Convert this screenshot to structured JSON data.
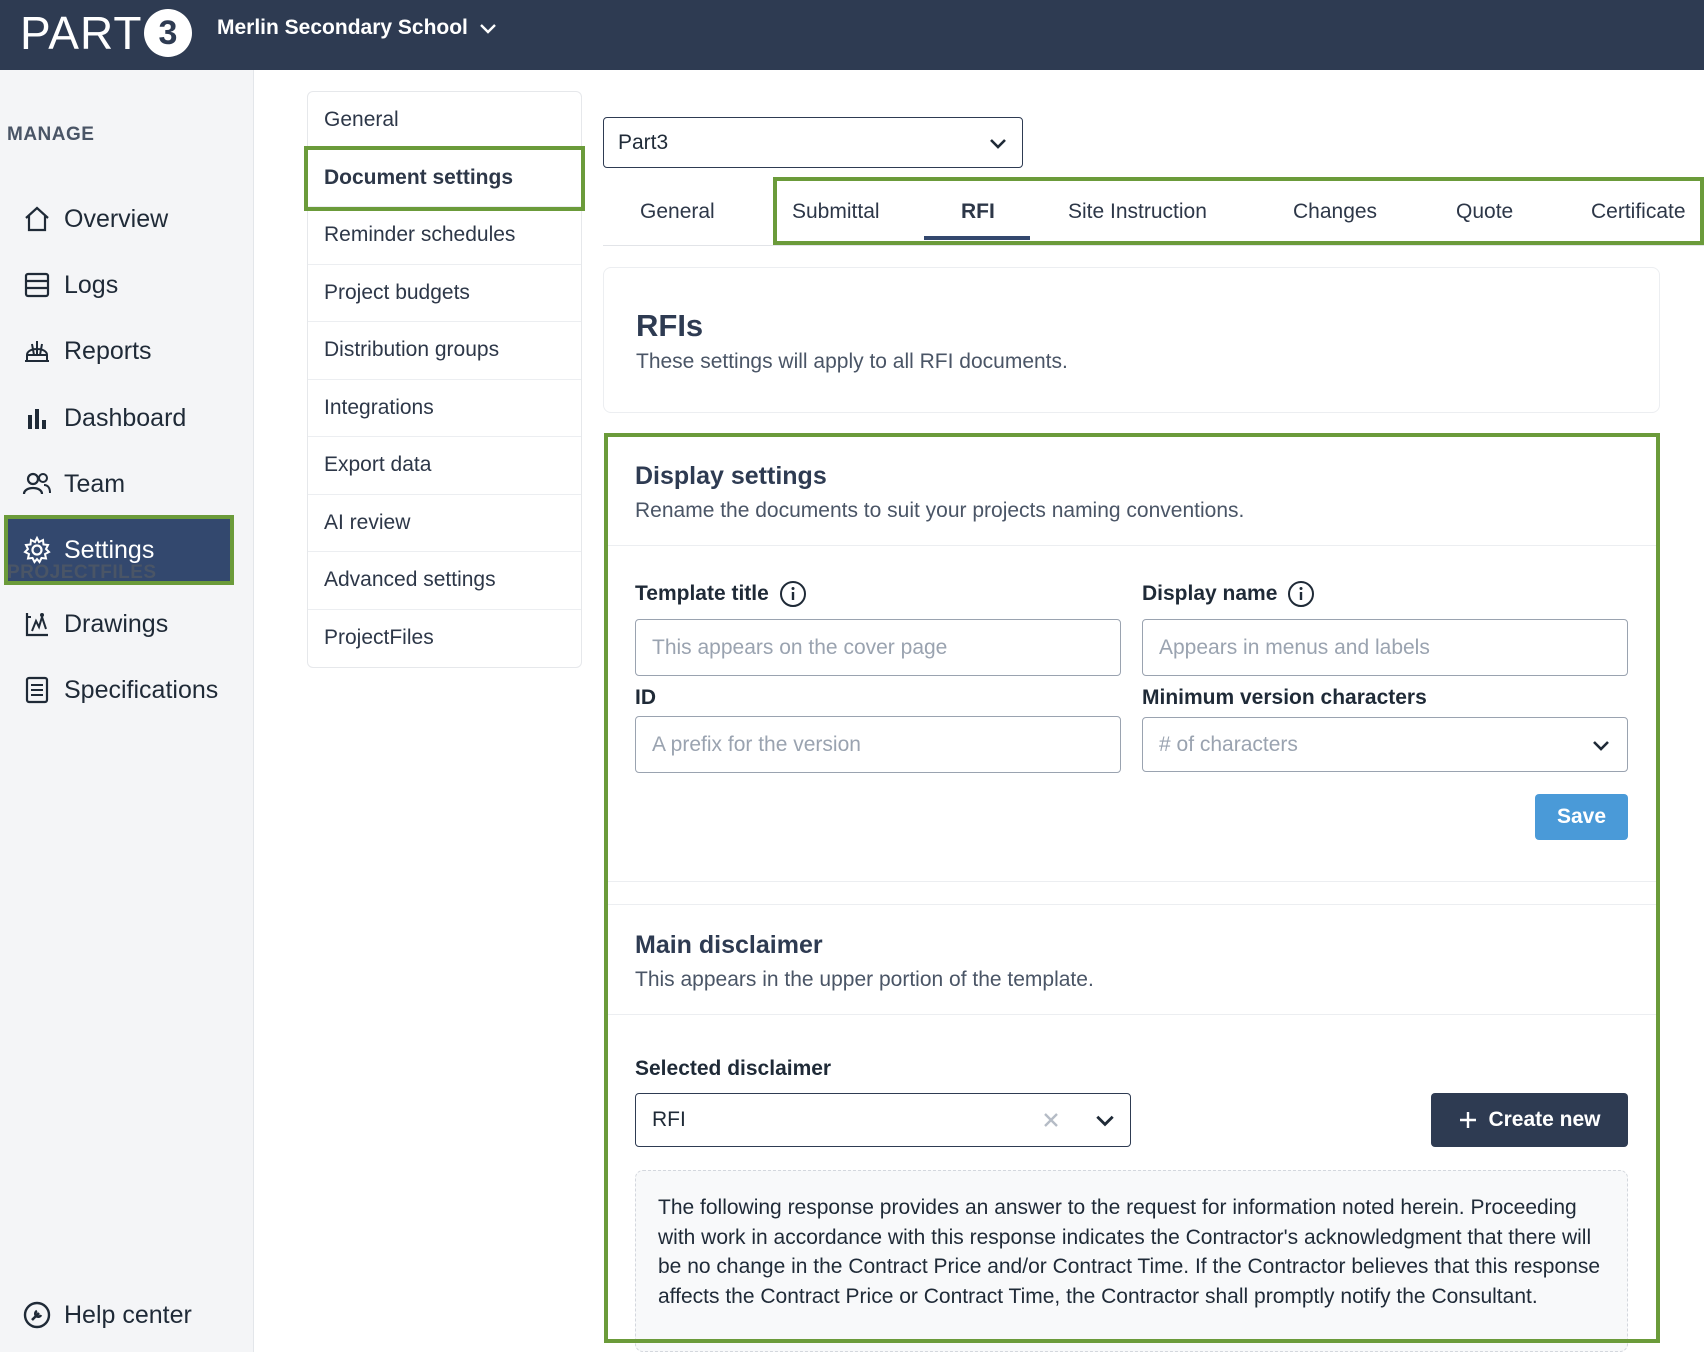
{
  "header": {
    "logo_text": "PART",
    "logo_badge": "3",
    "project_name": "Merlin Secondary School"
  },
  "sidebar": {
    "manage_label": "MANAGE",
    "items": [
      {
        "label": "Overview"
      },
      {
        "label": "Logs"
      },
      {
        "label": "Reports"
      },
      {
        "label": "Dashboard"
      },
      {
        "label": "Team"
      },
      {
        "label": "Settings"
      }
    ],
    "projectfiles_label": "PROJECTFILES",
    "pf_items": [
      {
        "label": "Drawings"
      },
      {
        "label": "Specifications"
      }
    ],
    "help_label": "Help center"
  },
  "subnav": {
    "items": [
      {
        "label": "General"
      },
      {
        "label": "Document settings"
      },
      {
        "label": "Reminder schedules"
      },
      {
        "label": "Project budgets"
      },
      {
        "label": "Distribution groups"
      },
      {
        "label": "Integrations"
      },
      {
        "label": "Export data"
      },
      {
        "label": "AI review"
      },
      {
        "label": "Advanced settings"
      },
      {
        "label": "ProjectFiles"
      }
    ]
  },
  "company_select": {
    "value": "Part3"
  },
  "tabs": [
    {
      "label": "General"
    },
    {
      "label": "Submittal"
    },
    {
      "label": "RFI"
    },
    {
      "label": "Site Instruction"
    },
    {
      "label": "Changes"
    },
    {
      "label": "Quote"
    },
    {
      "label": "Certificate"
    }
  ],
  "rfi_card": {
    "title": "RFIs",
    "subtitle": "These settings will apply to all RFI documents."
  },
  "display_settings": {
    "title": "Display settings",
    "subtitle": "Rename the documents to suit your projects naming conventions.",
    "template_title_label": "Template title",
    "template_title_placeholder": "This appears on the cover page",
    "display_name_label": "Display name",
    "display_name_placeholder": "Appears in menus and labels",
    "id_label": "ID",
    "id_placeholder": "A prefix for the version",
    "min_chars_label": "Minimum version characters",
    "min_chars_placeholder": "# of characters",
    "save_label": "Save"
  },
  "main_disclaimer": {
    "title": "Main disclaimer",
    "subtitle": "This appears in the upper portion of the template.",
    "selected_label": "Selected disclaimer",
    "selected_value": "RFI",
    "create_label": "Create new",
    "text": "The following response provides an answer to the request for information noted herein. Proceeding with work in accordance with this response indicates the Contractor's acknowledgment that there will be no change in the Contract Price and/or Contract Time. If the Contractor believes that this response affects the Contract Price or Contract Time, the Contractor shall promptly notify the Consultant."
  },
  "colors": {
    "topbar": "#2e3b52",
    "active_nav": "#33486e",
    "highlight": "#6b9b3a",
    "save_button": "#4a9ad8"
  }
}
